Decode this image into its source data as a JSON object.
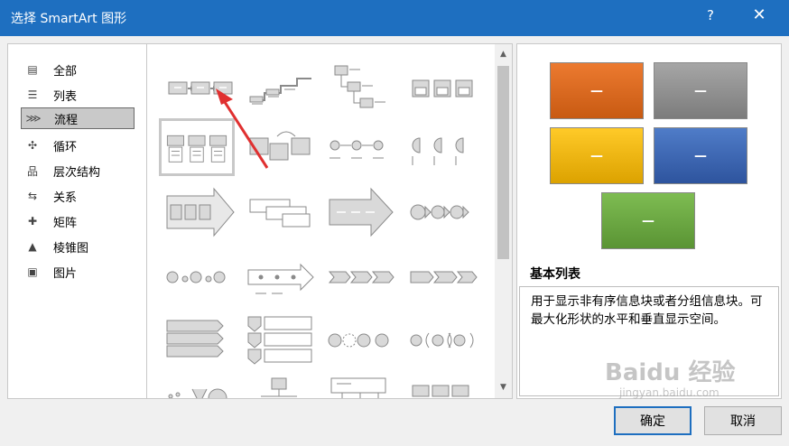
{
  "dialog": {
    "title": "选择 SmartArt 图形",
    "help_label": "?",
    "close_label": "✕"
  },
  "categories": [
    {
      "label": "全部",
      "icon": "all-icon",
      "glyph": "▤"
    },
    {
      "label": "列表",
      "icon": "list-icon",
      "glyph": "☰"
    },
    {
      "label": "流程",
      "icon": "process-icon",
      "glyph": "⋙",
      "selected": true
    },
    {
      "label": "循环",
      "icon": "cycle-icon",
      "glyph": "✣"
    },
    {
      "label": "层次结构",
      "icon": "hierarchy-icon",
      "glyph": "品"
    },
    {
      "label": "关系",
      "icon": "relationship-icon",
      "glyph": "⇆"
    },
    {
      "label": "矩阵",
      "icon": "matrix-icon",
      "glyph": "✚"
    },
    {
      "label": "棱锥图",
      "icon": "pyramid-icon",
      "glyph": "▲"
    },
    {
      "label": "图片",
      "icon": "picture-icon",
      "glyph": "▣"
    }
  ],
  "preview": {
    "name": "基本列表",
    "description": "用于显示非有序信息块或者分组信息块。可最大化形状的水平和垂直显示空间。",
    "box_text": "—",
    "colors": [
      "#e06b1e",
      "#8e8e8e",
      "#f0b400",
      "#3a62b0",
      "#6aa840"
    ]
  },
  "buttons": {
    "ok": "确定",
    "cancel": "取消"
  },
  "watermark": {
    "logo": "Baidu 经验",
    "url": "jingyan.baidu.com"
  }
}
